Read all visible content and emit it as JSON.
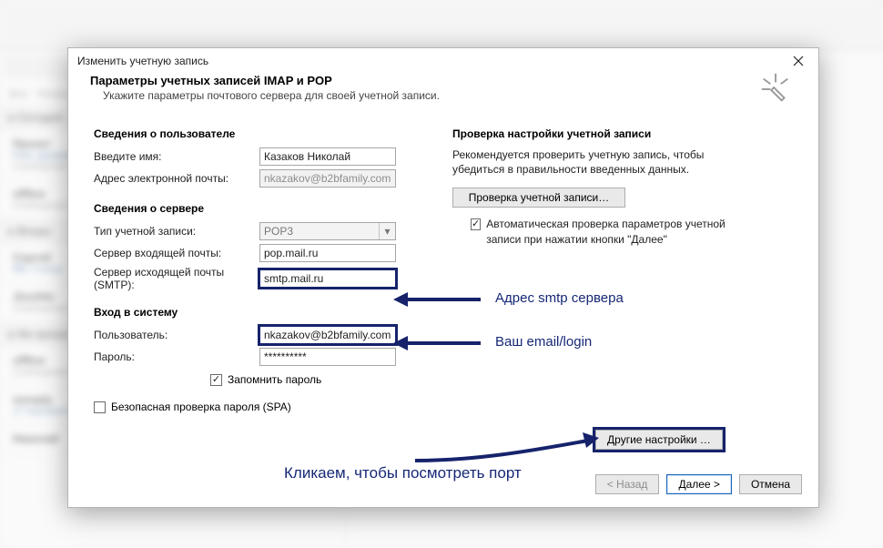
{
  "dialog": {
    "title": "Изменить учетную запись",
    "header_title": "Параметры учетных записей IMAP и POP",
    "header_sub": "Укажите параметры почтового сервера для своей учетной записи."
  },
  "left": {
    "user_section": "Сведения о пользователе",
    "name_label": "Введите имя:",
    "name_value": "Казаков Николай",
    "email_label": "Адрес электронной почты:",
    "email_value": "nkazakov@b2bfamily.com",
    "server_section": "Сведения о сервере",
    "acct_type_label": "Тип учетной записи:",
    "acct_type_value": "POP3",
    "incoming_label": "Сервер входящей почты:",
    "incoming_value": "pop.mail.ru",
    "smtp_label": "Сервер исходящей почты (SMTP):",
    "smtp_value": "smtp.mail.ru",
    "login_section": "Вход в систему",
    "user_label": "Пользователь:",
    "user_value": "nkazakov@b2bfamily.com",
    "pass_label": "Пароль:",
    "pass_value": "**********",
    "remember": "Запомнить пароль",
    "spa": "Безопасная проверка пароля (SPA)"
  },
  "right": {
    "verify_section": "Проверка настройки учетной записи",
    "verify_desc": "Рекомендуется проверить учетную запись, чтобы убедиться в правильности введенных данных.",
    "verify_btn": "Проверка учетной записи…",
    "auto_check": "Автоматическая проверка параметров учетной записи при нажатии кнопки \"Далее\"",
    "other_settings": "Другие настройки …"
  },
  "footer": {
    "back": "< Назад",
    "next": "Далее >",
    "cancel": "Отмена"
  },
  "annotations": {
    "smtp": "Адрес smtp сервера",
    "login": "Ваш email/login",
    "click": "Кликаем, чтобы посмотреть порт"
  }
}
